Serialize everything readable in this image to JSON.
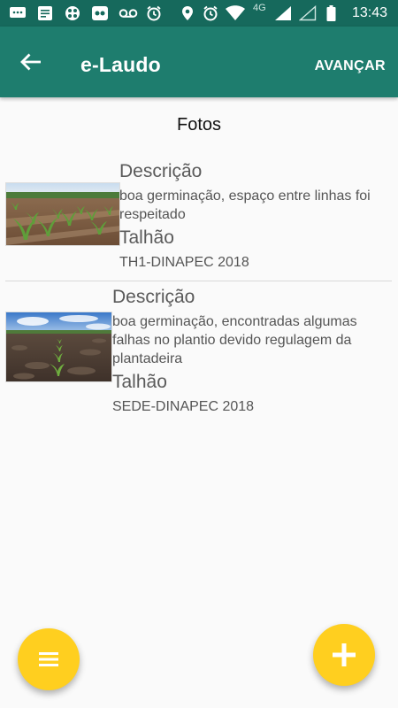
{
  "status_bar": {
    "network": "4G",
    "time": "13:43"
  },
  "app_bar": {
    "title": "e-Laudo",
    "action_label": "AVANÇAR"
  },
  "section": {
    "title": "Fotos"
  },
  "photos": [
    {
      "description_heading": "Descrição",
      "description": "boa germinação, espaço entre linhas foi respeitado",
      "field_heading": "Talhão",
      "field": "TH1-DINAPEC 2018"
    },
    {
      "description_heading": "Descrição",
      "description": "boa germinação, encontradas algumas falhas no plantio devido regulagem da plantadeira",
      "field_heading": "Talhão",
      "field": "SEDE-DINAPEC 2018"
    }
  ],
  "colors": {
    "primary": "#1e7d6e",
    "primary_dark": "#16695c",
    "fab": "#ffcf1f"
  },
  "icons": {
    "back": "arrow-back-icon",
    "menu": "menu-icon",
    "add": "plus-icon"
  }
}
